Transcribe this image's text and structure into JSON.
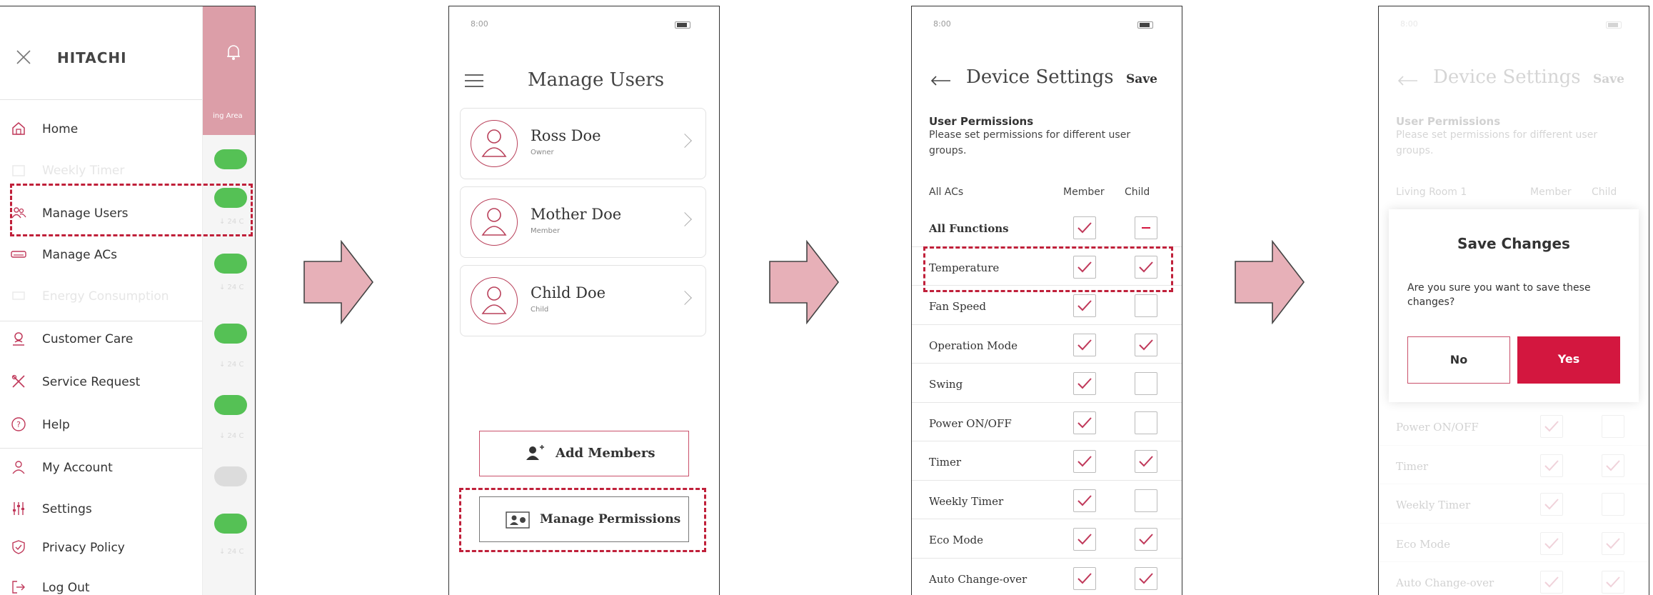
{
  "screen1": {
    "brand": "HITACHI",
    "strip_text": "ing Area",
    "menu": [
      {
        "label": "Home",
        "icon": "home-icon"
      },
      {
        "label": "Weekly Timer",
        "icon": "calendar-icon"
      },
      {
        "label": "Manage Users",
        "icon": "users-icon"
      },
      {
        "label": "Manage ACs",
        "icon": "ac-unit-icon"
      },
      {
        "label": "Energy Consumption",
        "icon": "energy-icon"
      },
      {
        "label": "Customer Care",
        "icon": "customer-care-icon"
      },
      {
        "label": "Service Request",
        "icon": "tools-icon"
      },
      {
        "label": "Help",
        "icon": "help-icon"
      },
      {
        "label": "My Account",
        "icon": "person-icon"
      },
      {
        "label": "Settings",
        "icon": "sliders-icon"
      },
      {
        "label": "Privacy Policy",
        "icon": "shield-icon"
      },
      {
        "label": "Log Out",
        "icon": "logout-icon"
      }
    ],
    "side_sub": "↓ 24 C"
  },
  "screen2": {
    "time": "8:00",
    "title": "Manage Users",
    "users": [
      {
        "name": "Ross Doe",
        "role": "Owner"
      },
      {
        "name": "Mother Doe",
        "role": "Member"
      },
      {
        "name": "Child Doe",
        "role": "Child"
      }
    ],
    "add_members": "Add Members",
    "manage_permissions": "Manage Permissions"
  },
  "screen3": {
    "time": "8:00",
    "title": "Device Settings",
    "save": "Save",
    "section_title": "User Permissions",
    "section_desc_1": "Please set permissions for different user",
    "section_desc_2": "groups.",
    "col_group": "All ACs",
    "col_member": "Member",
    "col_child": "Child",
    "rows": [
      {
        "label": "All Functions",
        "member": "checked",
        "child": "partial",
        "bold": true
      },
      {
        "label": "Temperature",
        "member": "checked",
        "child": "checked"
      },
      {
        "label": "Fan Speed",
        "member": "checked",
        "child": "empty"
      },
      {
        "label": "Operation Mode",
        "member": "checked",
        "child": "checked"
      },
      {
        "label": "Swing",
        "member": "checked",
        "child": "empty"
      },
      {
        "label": "Power ON/OFF",
        "member": "checked",
        "child": "empty"
      },
      {
        "label": "Timer",
        "member": "checked",
        "child": "checked"
      },
      {
        "label": "Weekly Timer",
        "member": "checked",
        "child": "empty"
      },
      {
        "label": "Eco Mode",
        "member": "checked",
        "child": "checked"
      },
      {
        "label": "Auto Change-over",
        "member": "checked",
        "child": "checked"
      }
    ]
  },
  "screen4": {
    "time": "8:00",
    "title": "Device Settings",
    "save": "Save",
    "section_title": "User Permissions",
    "section_desc_1": "Please set permissions for different user",
    "section_desc_2": "groups.",
    "col_group": "Living Room 1",
    "col_member": "Member",
    "col_child": "Child",
    "rows": [
      {
        "label": "Power ON/OFF",
        "member": "checked",
        "child": "empty"
      },
      {
        "label": "Timer",
        "member": "checked",
        "child": "checked"
      },
      {
        "label": "Weekly Timer",
        "member": "checked",
        "child": "empty"
      },
      {
        "label": "Eco Mode",
        "member": "checked",
        "child": "checked"
      },
      {
        "label": "Auto Change-over",
        "member": "checked",
        "child": "checked"
      }
    ],
    "dialog": {
      "title": "Save Changes",
      "message_1": "Are you sure you want to save these",
      "message_2": "changes?",
      "no": "No",
      "yes": "Yes"
    }
  },
  "colors": {
    "accent": "#d3173f",
    "check": "#c0395a",
    "strip": "#dc9ea8",
    "toggle_on": "#55c155",
    "arrow_fill": "#e7b0b8",
    "highlight": "#c0203a"
  }
}
